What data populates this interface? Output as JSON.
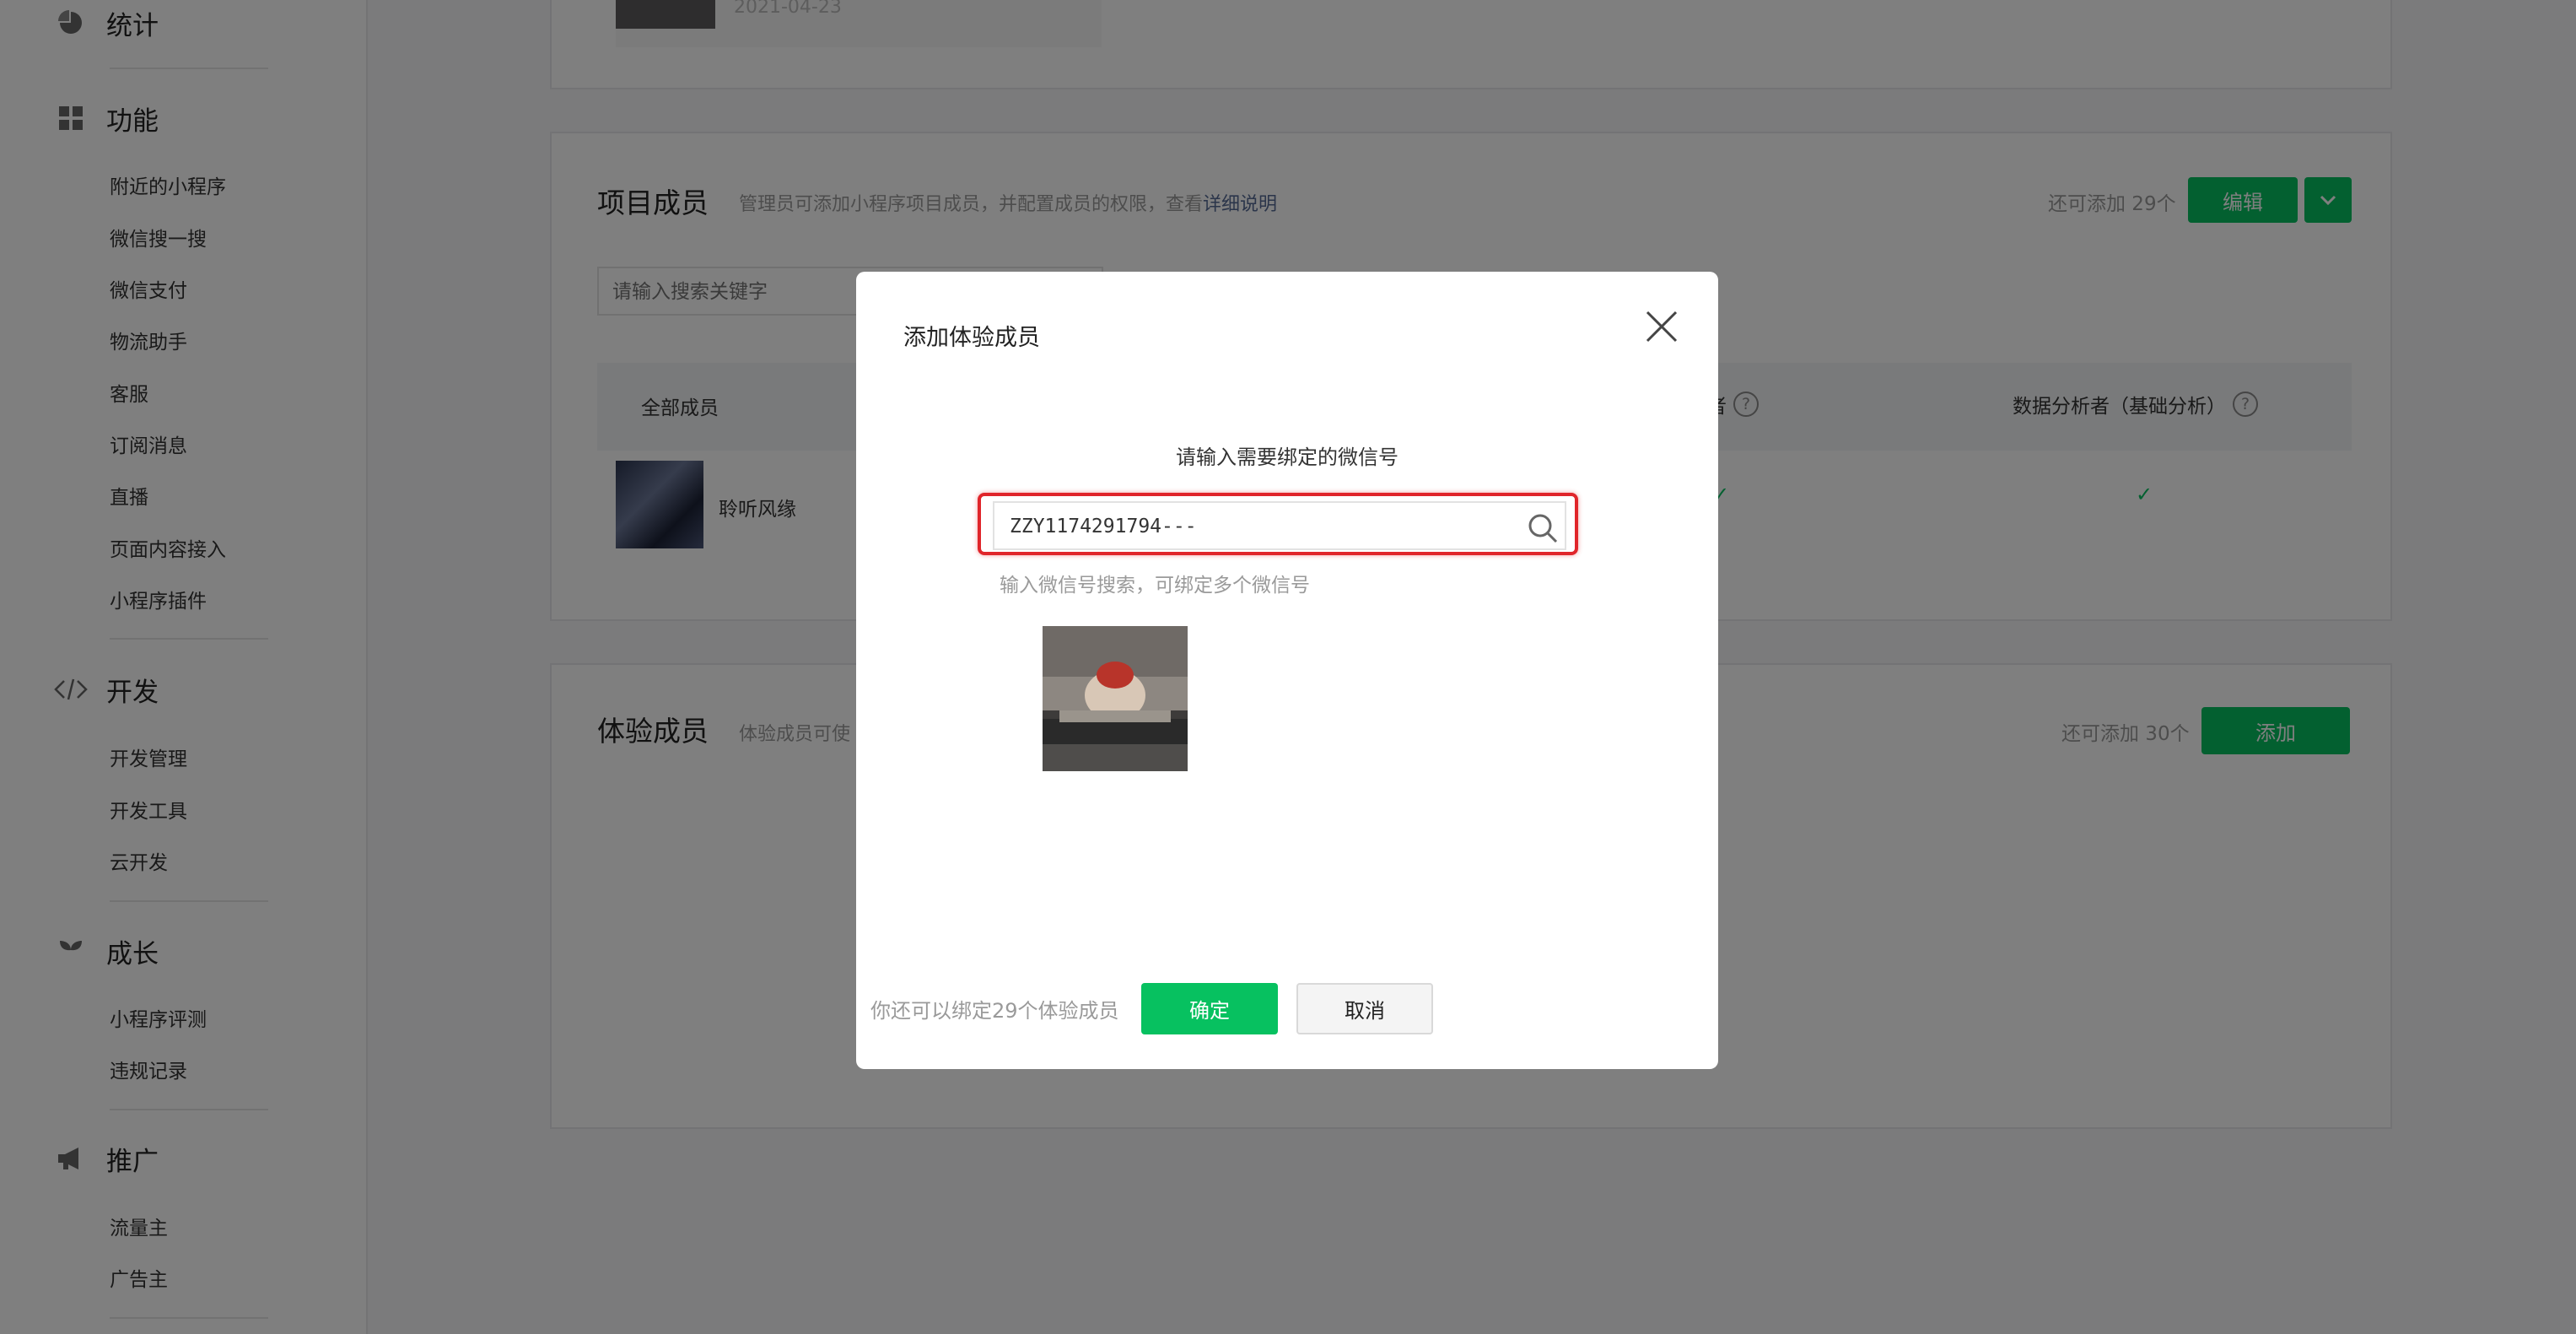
{
  "sidebar": {
    "stats": {
      "label": "统计"
    },
    "features": {
      "label": "功能",
      "items": [
        "附近的小程序",
        "微信搜一搜",
        "微信支付",
        "物流助手",
        "客服",
        "订阅消息",
        "直播",
        "页面内容接入",
        "小程序插件"
      ]
    },
    "develop": {
      "label": "开发",
      "items": [
        "开发管理",
        "开发工具",
        "云开发"
      ]
    },
    "growth": {
      "label": "成长",
      "items": [
        "小程序评测",
        "违规记录"
      ]
    },
    "promote": {
      "label": "推广",
      "items": [
        "流量主",
        "广告主"
      ]
    }
  },
  "top_card": {
    "date": "2021-04-23"
  },
  "project_members": {
    "title": "项目成员",
    "desc": "管理员可添加小程序项目成员，并配置成员的权限，查看",
    "desc_link": "详细说明",
    "quota": "还可添加 29个",
    "edit_button": "编辑",
    "search_placeholder": "请输入搜索关键字",
    "columns": {
      "all": "全部成员",
      "partial": "者",
      "analyst": "数据分析者（基础分析）"
    },
    "rows": [
      {
        "name": "聆听风缘"
      }
    ]
  },
  "experience_members": {
    "title": "体验成员",
    "desc": "体验成员可使",
    "quota": "还可添加 30个",
    "add_button": "添加"
  },
  "modal": {
    "title": "添加体验成员",
    "prompt": "请输入需要绑定的微信号",
    "input_value": "ZZY1174291794---",
    "hint": "输入微信号搜索，可绑定多个微信号",
    "footer_note": "你还可以绑定29个体验成员",
    "confirm": "确定",
    "cancel": "取消"
  },
  "colors": {
    "accent": "#07c160",
    "highlight": "#e0252a",
    "link": "#576b95"
  }
}
